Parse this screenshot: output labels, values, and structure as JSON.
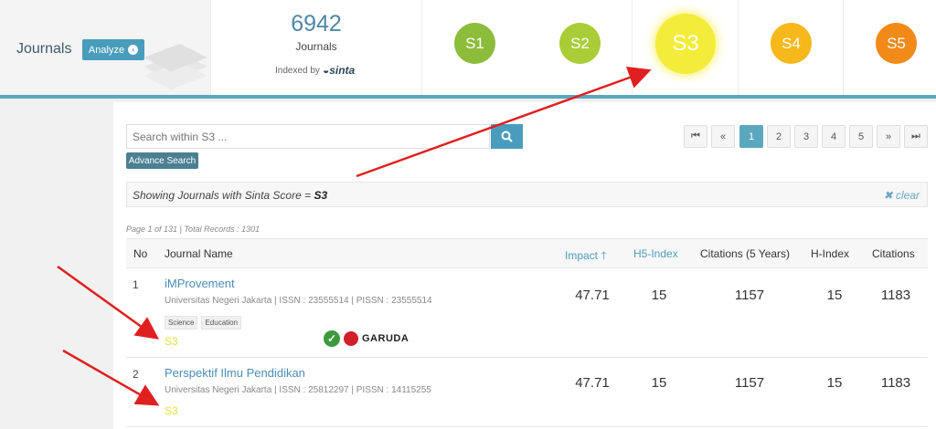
{
  "header": {
    "title": "Journals",
    "analyze_label": "Analyze",
    "journal_count": "6942",
    "journal_count_label": "Journals",
    "indexed_by": "Indexed by",
    "sinta_logo": "sinta",
    "scores": [
      {
        "label": "S1",
        "color": "#8bbd3b"
      },
      {
        "label": "S2",
        "color": "#a9cc37"
      },
      {
        "label": "S3",
        "color": "#f4ec3a"
      },
      {
        "label": "S4",
        "color": "#f6b81a"
      },
      {
        "label": "S5",
        "color": "#f28a1a"
      }
    ]
  },
  "search": {
    "placeholder": "Search within S3 ...",
    "advance_label": "Advance Search"
  },
  "pagination": {
    "first": "⏮",
    "prev": "«",
    "pages": [
      "1",
      "2",
      "3",
      "4",
      "5"
    ],
    "active": "1",
    "next": "»",
    "last": "⏭"
  },
  "filter": {
    "prefix": "Showing Journals with Sinta Score = ",
    "value": "S3",
    "clear": "clear"
  },
  "records_info": "Page 1 of 131 | Total Records : 1301",
  "table": {
    "columns": [
      "No",
      "Journal Name",
      "Impact",
      "H5-Index",
      "Citations (5 Years)",
      "H-Index",
      "Citations"
    ],
    "rows": [
      {
        "no": "1",
        "title": "iMProvement",
        "meta": "Universitas Negeri Jakarta | ISSN : 23555514 | PISSN : 23555514",
        "tags": [
          "Science",
          "Education"
        ],
        "score": "S3",
        "garuda": "GARUDA",
        "impact": "47.71",
        "h5": "15",
        "cit5": "1157",
        "hindex": "15",
        "citations": "1183"
      },
      {
        "no": "2",
        "title": "Perspektif Ilmu Pendidikan",
        "meta": "Universitas Negeri Jakarta | ISSN : 25812297 | PISSN : 14115255",
        "tags": [],
        "score": "S3",
        "impact": "47.71",
        "h5": "15",
        "cit5": "1157",
        "hindex": "15",
        "citations": "1183"
      }
    ]
  },
  "annotation_color": "#e02020"
}
